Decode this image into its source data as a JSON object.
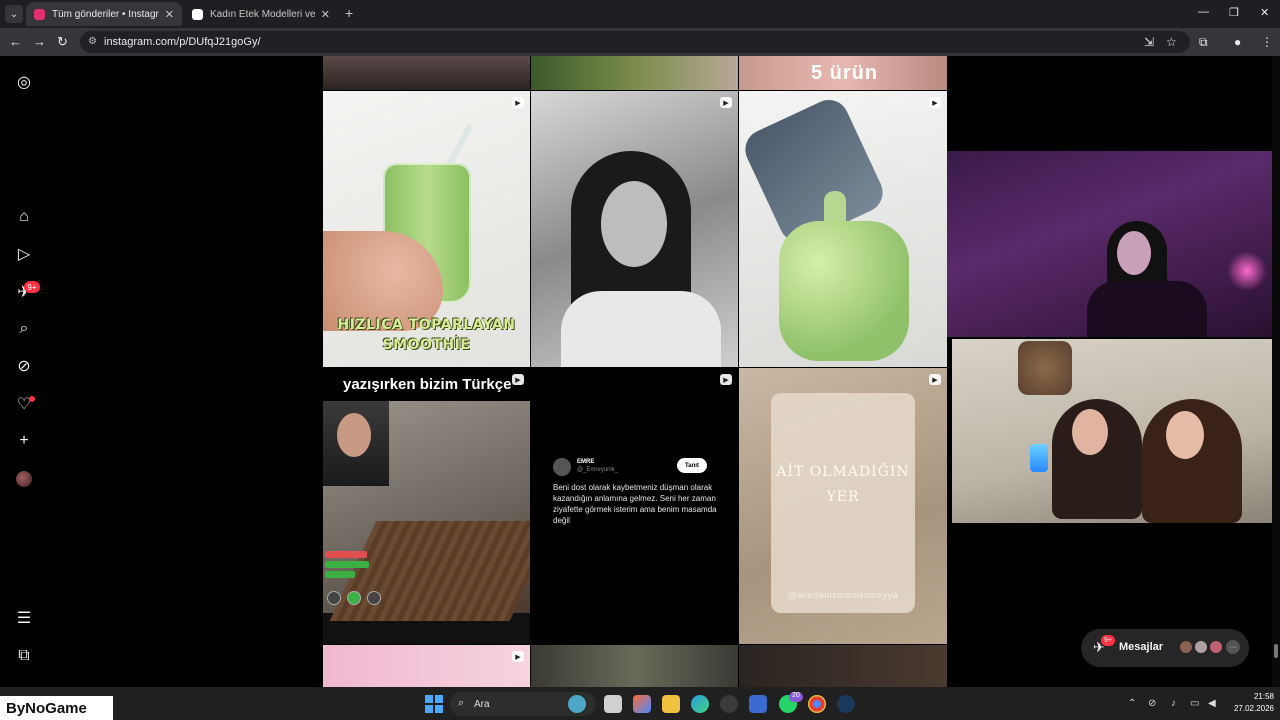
{
  "browser": {
    "tabs": [
      {
        "title": "Tüm gönderiler • Instagram",
        "active": true,
        "favicon_color": "#e1306c"
      },
      {
        "title": "Kadın Etek Modelleri ve Fiyatları",
        "active": false,
        "favicon_color": "#ffffff"
      }
    ],
    "new_tab_label": "+",
    "url": "instagram.com/p/DUfqJ21goGy/"
  },
  "instagram": {
    "sidebar": {
      "items": [
        {
          "name": "instagram-logo-icon",
          "glyph": "◎"
        },
        {
          "name": "home-icon",
          "glyph": "⌂"
        },
        {
          "name": "reels-icon",
          "glyph": "▷"
        },
        {
          "name": "messages-icon",
          "glyph": "✈"
        },
        {
          "name": "search-icon",
          "glyph": "⌕"
        },
        {
          "name": "explore-icon",
          "glyph": "⊘"
        },
        {
          "name": "notifications-icon",
          "glyph": "♡"
        },
        {
          "name": "create-icon",
          "glyph": "+"
        },
        {
          "name": "more-menu-icon",
          "glyph": "☰"
        },
        {
          "name": "also-from-meta-icon",
          "glyph": "⧉"
        }
      ],
      "messages_badge": "9+"
    },
    "posts": {
      "top3_text": "5 ürün",
      "smoothie_line1": "HIZLICA TOPARLAYAN",
      "smoothie_line2": "SMOOTHİE",
      "turkce_title": "yazışırken bizim Türkçe",
      "tweet_name": "EMRE",
      "tweet_handle": "@_Emreyunik_",
      "tweet_button": "Tanıt",
      "tweet_text": "Beni dost olarak kaybetmeniz düşman olarak kazandığın anlamına gelmez. Seni her zaman ziyafette görmek isterim ama benim masamda değil",
      "ait_text": "AİT OLMADIĞIN YER",
      "ait_handle": "@ailedanismanisumeyya"
    },
    "messages_pill": {
      "label": "Mesajlar",
      "badge": "9+",
      "more": "···"
    }
  },
  "taskbar": {
    "watermark": "ByNoGame",
    "search_placeholder": "Ara",
    "whatsapp_badge": "20",
    "time": "21:58",
    "date": "27.02.2026"
  }
}
